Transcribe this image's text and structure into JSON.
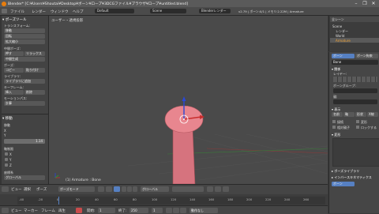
{
  "window": {
    "title": "Blender* [C:¥Users¥Shoutai¥Desktop¥ボーン¥ロープ¥3DCGファイル¥ブラウザ¥ロープ¥untitled.blend]",
    "controls": [
      "–",
      "❐",
      "✕"
    ]
  },
  "info_header": {
    "menus": [
      "ファイル",
      "レンダー",
      "ウィンドウ",
      "ヘルプ"
    ],
    "screen_layout": "Default",
    "scene": "Scene",
    "render_engine": "Blenderレンダー",
    "stats": "v2.79 | ボーン:0/1 | メモリ:2.22M | Armature"
  },
  "tool_shelf": {
    "section_pose_tools": "▾ ポーズツール",
    "transform_label": "トランスフォーム:",
    "transform_buttons": [
      "移動",
      "回転",
      "拡大縮小"
    ],
    "in_between_label": "中間ポーズ:",
    "in_between_buttons": [
      "押す",
      "リラックス",
      "中間生成"
    ],
    "pose_label": "ポーズ:",
    "pose_buttons": [
      "コピー",
      "貼り付け"
    ],
    "library_label": "ライブラリ:",
    "library_button": "ライブラリに追加",
    "keyframe_label": "キーフレーム:",
    "keyframe_buttons": [
      "挿入",
      "削除"
    ],
    "motion_path_label": "モーションパス:",
    "motion_path_button": "計算",
    "section_redo": "▾ 移動",
    "redo_labels": [
      "移動",
      "X",
      "Y",
      "Z"
    ],
    "value_field": "1.14",
    "constraint_label": "軸制限",
    "checkbox_labels": [
      "X",
      "Y",
      "Z"
    ],
    "orientation_label": "座標系",
    "orientation_value": "グローバル"
  },
  "viewport": {
    "view_label": "ユーザー・透視投影",
    "object_label": "(1) Armature : Bone"
  },
  "viewport_header": {
    "menus": [
      "ビュー",
      "選択",
      "ポーズ"
    ],
    "mode": "ポーズモード",
    "pivot": "グローバル"
  },
  "outliner": {
    "search_label": "全シーン",
    "items": [
      "Scene",
      "レンダー",
      "World",
      "Armature"
    ]
  },
  "properties": {
    "tabs": [
      "ボーン",
      "ボーン拘束"
    ],
    "bone_name": "Bone",
    "relations_label": "▾ 関係",
    "layer_label": "レイヤー:",
    "bone_group_label": "ボーングループ:",
    "parent_label": "親:",
    "display_label": "▾ 表示",
    "display_options": [
      "名前",
      "軸",
      "形状",
      "X線"
    ],
    "checkbox_rows": [
      "接続",
      "変形",
      "相対親子",
      "ロックする"
    ],
    "deform_label": "▾ 変形",
    "section_labels": [
      "▸ ポーズライブラリ",
      "▸ インバースキネマティクス"
    ],
    "bottom_button": "ボーン"
  },
  "timeline": {
    "ticks": [
      "-40",
      "-20",
      "0",
      "20",
      "40",
      "60",
      "80",
      "100",
      "120",
      "140",
      "160",
      "180",
      "200",
      "220",
      "240",
      "260"
    ],
    "menus": [
      "ビュー",
      "マーカー",
      "フレーム",
      "再生"
    ],
    "start_label": "開始:",
    "start_value": "1",
    "end_label": "終了:",
    "end_value": "250",
    "current_frame": "1",
    "keying": "動作なし"
  },
  "colors": {
    "bone": "#e8868f",
    "bone_dark": "#b75962",
    "axis_x": "#c92c2c",
    "axis_y": "#2b9a2b",
    "axis_z": "#2a48d6",
    "accent_orange": "#e87d0d",
    "selected_blue": "#5680c2"
  }
}
